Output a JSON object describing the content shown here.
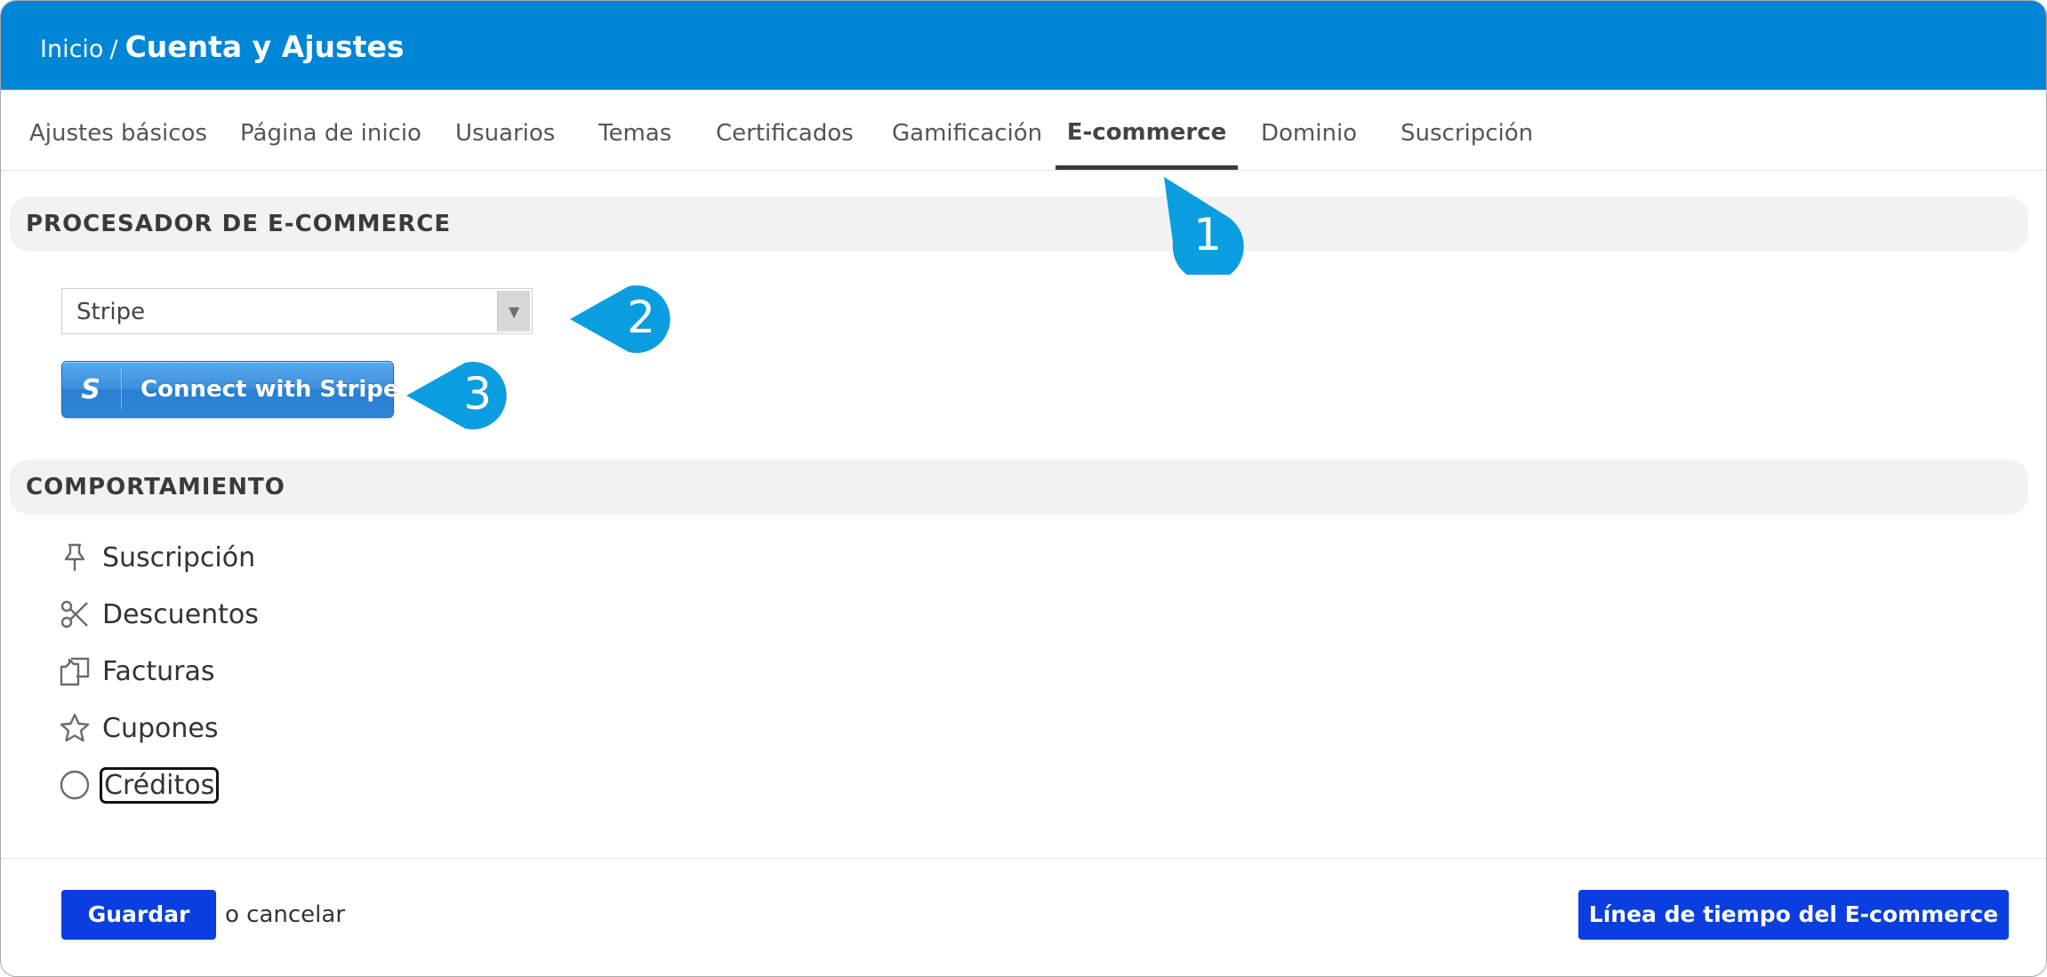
{
  "breadcrumb": {
    "home": "Inicio",
    "separator": "/",
    "current": "Cuenta y Ajustes"
  },
  "tabs": [
    {
      "label": "Ajustes básicos"
    },
    {
      "label": "Página de inicio"
    },
    {
      "label": "Usuarios"
    },
    {
      "label": "Temas"
    },
    {
      "label": "Certificados"
    },
    {
      "label": "Gamificación"
    },
    {
      "label": "E-commerce",
      "active": true
    },
    {
      "label": "Dominio"
    },
    {
      "label": "Suscripción"
    }
  ],
  "processor": {
    "title": "PROCESADOR DE E-COMMERCE",
    "select_value": "Stripe",
    "connect_label": "Connect with Stripe",
    "connect_logo": "S"
  },
  "behavior": {
    "title": "COMPORTAMIENTO",
    "items": [
      {
        "label": "Suscripción",
        "icon": "pin-icon"
      },
      {
        "label": "Descuentos",
        "icon": "scissors-icon"
      },
      {
        "label": "Facturas",
        "icon": "invoices-icon"
      },
      {
        "label": "Cupones",
        "icon": "star-icon"
      },
      {
        "label": "Créditos",
        "icon": "circle-icon"
      }
    ]
  },
  "footer": {
    "save_label": "Guardar",
    "cancel_text": "o cancelar",
    "timeline_label": "Línea de tiempo del E-commerce"
  },
  "callouts": [
    "1",
    "2",
    "3"
  ],
  "colors": {
    "topbar": "#0086d6",
    "primary_button": "#0a3ee0",
    "callout": "#0a9ee0",
    "section_bg": "#f2f2f2"
  }
}
